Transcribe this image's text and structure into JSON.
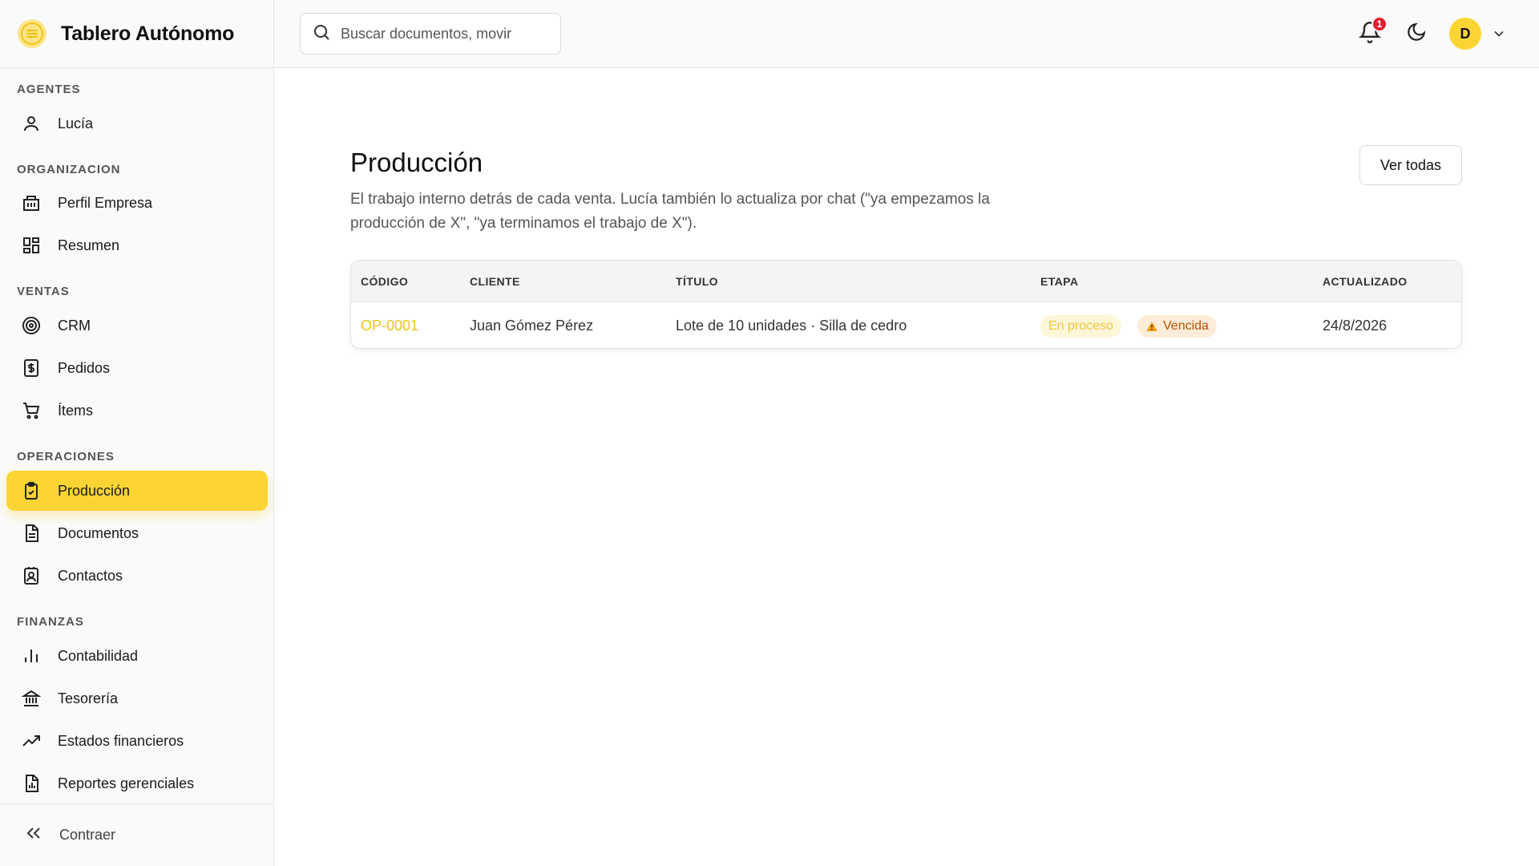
{
  "app": {
    "title": "Tablero Autónomo"
  },
  "search": {
    "placeholder": "Buscar documentos, movir"
  },
  "header": {
    "notifications_count": "1",
    "avatar_initial": "D"
  },
  "sidebar": {
    "sections": [
      {
        "label": "AGENTES",
        "items": [
          {
            "label": "Lucía",
            "icon": "user-icon"
          }
        ]
      },
      {
        "label": "ORGANIZACION",
        "items": [
          {
            "label": "Perfil Empresa",
            "icon": "building-icon"
          },
          {
            "label": "Resumen",
            "icon": "dashboard-icon"
          }
        ]
      },
      {
        "label": "VENTAS",
        "items": [
          {
            "label": "CRM",
            "icon": "target-icon"
          },
          {
            "label": "Pedidos",
            "icon": "invoice-dollar-icon"
          },
          {
            "label": "Ítems",
            "icon": "cart-icon"
          }
        ]
      },
      {
        "label": "OPERACIONES",
        "items": [
          {
            "label": "Producción",
            "icon": "clipboard-check-icon",
            "active": true
          },
          {
            "label": "Documentos",
            "icon": "document-icon"
          },
          {
            "label": "Contactos",
            "icon": "contact-book-icon"
          }
        ]
      },
      {
        "label": "FINANZAS",
        "items": [
          {
            "label": "Contabilidad",
            "icon": "bar-chart-icon"
          },
          {
            "label": "Tesorería",
            "icon": "bank-icon"
          },
          {
            "label": "Estados financieros",
            "icon": "trending-up-icon"
          },
          {
            "label": "Reportes gerenciales",
            "icon": "report-icon"
          }
        ]
      }
    ],
    "collapse_label": "Contraer"
  },
  "main": {
    "title": "Producción",
    "description": "El trabajo interno detrás de cada venta. Lucía también lo actualiza por chat (\"ya empezamos la producción de X\", \"ya terminamos el trabajo de X\").",
    "view_all_label": "Ver todas",
    "table": {
      "columns": [
        "CÓDIGO",
        "CLIENTE",
        "TÍTULO",
        "ETAPA",
        "ACTUALIZADO"
      ],
      "rows": [
        {
          "code": "OP-0001",
          "client": "Juan Gómez Pérez",
          "title": "Lote de 10 unidades · Silla de cedro",
          "stage": "En proceso",
          "status": "Vencida",
          "updated": "24/8/2026"
        }
      ]
    }
  },
  "colors": {
    "accent": "#fcd535",
    "code": "#f2c318",
    "badge": "#e11d2e",
    "overdue": "#b45309"
  }
}
